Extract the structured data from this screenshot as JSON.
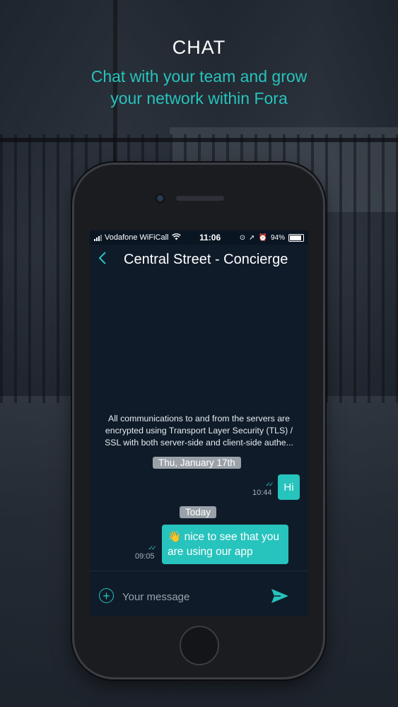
{
  "header": {
    "title": "CHAT",
    "subtitle_line1": "Chat with your team and grow",
    "subtitle_line2": "your network within Fora"
  },
  "status_bar": {
    "carrier": "Vodafone WiFiCall",
    "time": "11:06",
    "battery": "94%"
  },
  "chat": {
    "title": "Central Street - Concierge",
    "info_line1": "All communications to and from the servers are",
    "info_line2": "encrypted using Transport Layer Security (TLS) /",
    "info_line3": "SSL with both server-side and client-side authe...",
    "messages": [
      {
        "date_label": "Thu, January 17th",
        "text": "Hi",
        "time": "10:44"
      },
      {
        "date_label": "Today",
        "emoji": "👋",
        "text_line1": " nice to see that you",
        "text_line2": "are using our app",
        "time": "09:05"
      }
    ],
    "composer_placeholder": "Your message"
  },
  "colors": {
    "accent": "#27c3bd",
    "screen_bg": "#0f1b29",
    "pill_bg": "#9aa1a8"
  },
  "icons": [
    "back-chevron-icon",
    "signal-icon",
    "wifi-icon",
    "alarm-icon",
    "location-icon",
    "battery-icon",
    "add-circle-icon",
    "send-icon"
  ]
}
